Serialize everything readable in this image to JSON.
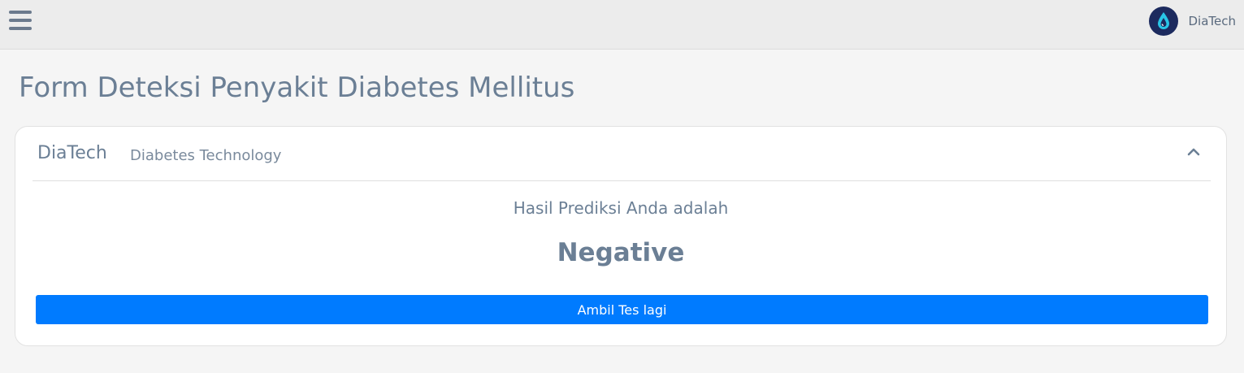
{
  "topbar": {
    "menu_icon": "hamburger-menu-icon",
    "logo_icon": "droplet-logo-icon",
    "user_name": "DiaTech"
  },
  "page": {
    "title": "Form Deteksi Penyakit Diabetes Mellitus"
  },
  "card": {
    "title": "DiaTech",
    "subtitle": "Diabetes Technology",
    "collapse_icon": "chevron-up-icon",
    "result_label": "Hasil Prediksi Anda adalah",
    "result_value": "Negative",
    "retake_button_label": "Ambil Tes lagi"
  },
  "colors": {
    "topbar_bg": "#ececec",
    "page_bg": "#f5f5f5",
    "text_muted": "#6b7f95",
    "primary": "#007bff",
    "logo_bg": "#1c2a5e",
    "logo_accent": "#29c5e6"
  }
}
